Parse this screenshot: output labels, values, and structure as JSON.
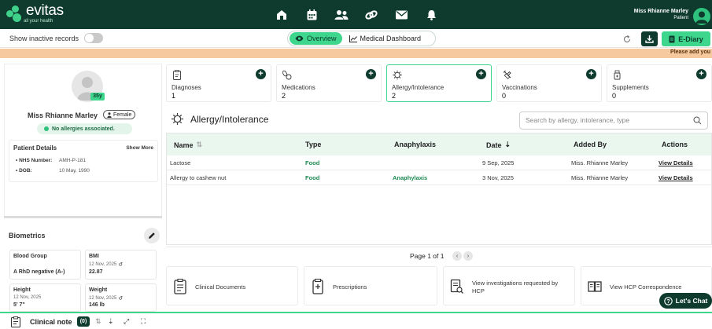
{
  "app": {
    "logo_text": "evitas",
    "logo_tagline": "all your health",
    "colors": {
      "brand_dark": "#0e3b2e",
      "brand_accent": "#3dd68c",
      "notice_bg": "#f7c99e",
      "table_head_bg": "#eaf7ef"
    }
  },
  "topnav": {
    "icons": [
      "home-icon",
      "calendar-icon",
      "people-icon",
      "link-icon",
      "mail-icon",
      "bell-icon"
    ]
  },
  "user": {
    "name": "Miss Rhianne Marley",
    "role": "Patient"
  },
  "toolbar": {
    "show_inactive_label": "Show inactive records",
    "show_inactive_on": false,
    "overview_label": "Overview",
    "dashboard_label": "Medical Dashboard",
    "ediary_label": "E-Diary"
  },
  "notice": {
    "text": "Please add you"
  },
  "patient": {
    "age": "35y",
    "name": "Miss Rhianne Marley",
    "gender": "Female",
    "allergy_status": "No allergies associated.",
    "details_title": "Patient Details",
    "show_more": "Show More",
    "nhs_label": "NHS Number:",
    "nhs_value": "AMH-P-181",
    "dob_label": "DOB:",
    "dob_value": "10 May, 1990"
  },
  "biometrics": {
    "title": "Biometrics",
    "blood_group": {
      "label": "Blood Group",
      "value": "A RhD negative (A-)"
    },
    "bmi": {
      "label": "BMI",
      "date": "12 Nov, 2025",
      "value": "22.87"
    },
    "height": {
      "label": "Height",
      "date": "12 Nov, 2025",
      "value": "5' 7\""
    },
    "weight": {
      "label": "Weight",
      "date": "12 Nov, 2025",
      "value": "146 lb"
    }
  },
  "categories": [
    {
      "label": "Diagnoses",
      "count": "1"
    },
    {
      "label": "Medications",
      "count": "2"
    },
    {
      "label": "Allergy/Intolerance",
      "count": "2"
    },
    {
      "label": "Vaccinations",
      "count": "0"
    },
    {
      "label": "Supplements",
      "count": "0"
    }
  ],
  "section": {
    "title": "Allergy/Intolerance",
    "search_placeholder": "Search by allergy, intolerance, type"
  },
  "table": {
    "headers": {
      "name": "Name",
      "type": "Type",
      "anaphylaxis": "Anaphylaxis",
      "date": "Date",
      "added_by": "Added By",
      "actions": "Actions"
    },
    "rows": [
      {
        "name": "Lactose",
        "type": "Food",
        "anaphylaxis": "",
        "date": "9 Sep, 2025",
        "added_by": "Miss. Rhianne Marley",
        "action": "View Details"
      },
      {
        "name": "Allergy to cashew nut",
        "type": "Food",
        "anaphylaxis": "Anaphylaxis",
        "date": "3 Nov, 2025",
        "added_by": "Miss. Rhianne Marley",
        "action": "View Details"
      }
    ]
  },
  "pager": {
    "text": "Page 1 of 1"
  },
  "bottom_cards": [
    {
      "label": "Clinical Documents"
    },
    {
      "label": "Prescriptions"
    },
    {
      "label": "View investigations requested by HCP"
    },
    {
      "label": "View HCP Correspondence"
    }
  ],
  "chat": {
    "label": "Let's Chat"
  },
  "clinical_note": {
    "label": "Clinical note",
    "count": "(0)"
  }
}
